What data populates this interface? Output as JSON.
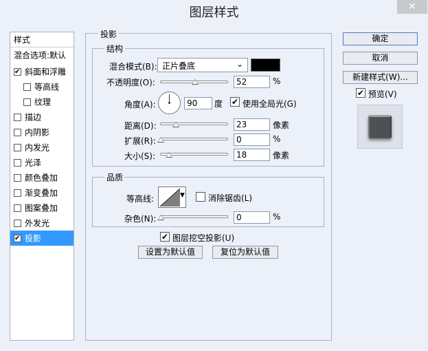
{
  "window": {
    "title": "图层样式",
    "close_symbol": "✕"
  },
  "sidebar": {
    "header": "样式",
    "items": [
      {
        "label": "混合选项:默认",
        "checkbox": false
      },
      {
        "label": "斜面和浮雕",
        "checkbox": true,
        "checked": true
      },
      {
        "label": "等高线",
        "checkbox": true,
        "checked": false
      },
      {
        "label": "纹理",
        "checkbox": true,
        "checked": false
      },
      {
        "label": "描边",
        "checkbox": true,
        "checked": false
      },
      {
        "label": "内阴影",
        "checkbox": true,
        "checked": false
      },
      {
        "label": "内发光",
        "checkbox": true,
        "checked": false
      },
      {
        "label": "光泽",
        "checkbox": true,
        "checked": false
      },
      {
        "label": "颜色叠加",
        "checkbox": true,
        "checked": false
      },
      {
        "label": "渐变叠加",
        "checkbox": true,
        "checked": false
      },
      {
        "label": "图案叠加",
        "checkbox": true,
        "checked": false
      },
      {
        "label": "外发光",
        "checkbox": true,
        "checked": false
      },
      {
        "label": "投影",
        "checkbox": true,
        "checked": true,
        "selected": true
      }
    ]
  },
  "panel": {
    "title": "投影",
    "structure": {
      "title": "结构",
      "blend_mode_label": "混合模式(B):",
      "blend_mode_value": "正片叠底",
      "shadow_color": "#000000",
      "opacity_label": "不透明度(O):",
      "opacity_value": "52",
      "opacity_unit": "%",
      "angle_label": "角度(A):",
      "angle_value": "90",
      "angle_unit": "度",
      "global_light_label": "使用全局光(G)",
      "global_light_checked": true,
      "distance_label": "距离(D):",
      "distance_value": "23",
      "distance_unit": "像素",
      "spread_label": "扩展(R):",
      "spread_value": "0",
      "spread_unit": "%",
      "size_label": "大小(S):",
      "size_value": "18",
      "size_unit": "像素"
    },
    "quality": {
      "title": "品质",
      "contour_label": "等高线:",
      "antialias_label": "消除锯齿(L)",
      "antialias_checked": false,
      "noise_label": "杂色(N):",
      "noise_value": "0",
      "noise_unit": "%"
    },
    "knockout_label": "图层挖空投影(U)",
    "knockout_checked": true,
    "set_default_label": "设置为默认值",
    "reset_default_label": "复位为默认值"
  },
  "actions": {
    "ok_label": "确定",
    "cancel_label": "取消",
    "new_style_label": "新建样式(W)...",
    "preview_label": "预览(V)",
    "preview_checked": true
  },
  "colors": {
    "dialog_bg": "#ecf0f9",
    "selected_bg": "#3399ff"
  }
}
